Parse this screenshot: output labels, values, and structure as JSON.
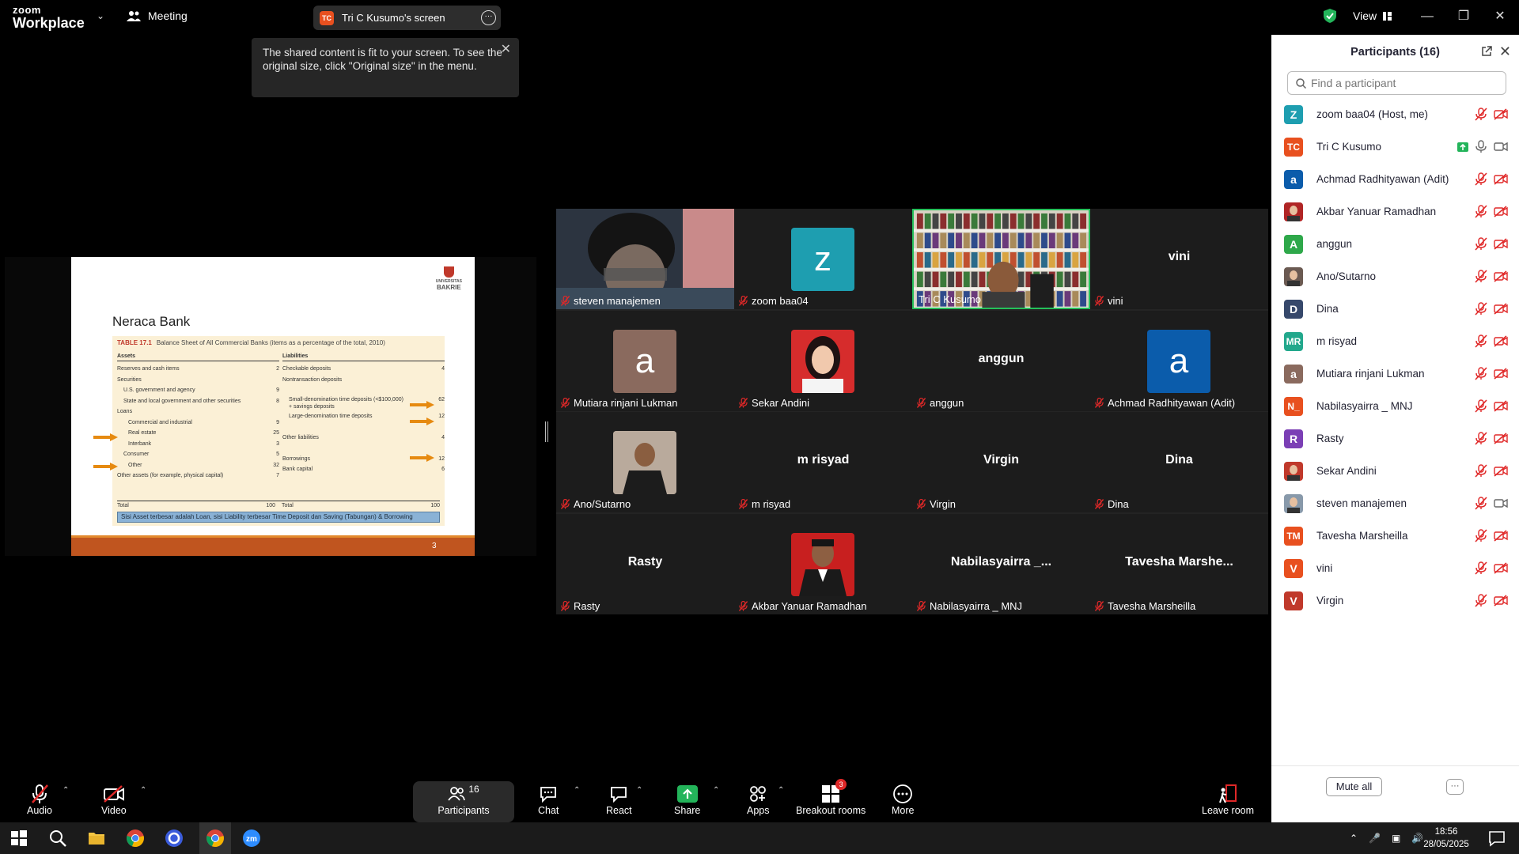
{
  "app": {
    "logo_top": "zoom",
    "logo_bottom": "Workplace",
    "meeting_label": "Meeting",
    "screen_tab_badge": "TC",
    "screen_tab_label": "Tri C Kusumo's screen",
    "view_label": "View",
    "tooltip": "The shared content is fit to your screen. To see the original size, click \"Original size\" in the menu."
  },
  "slide": {
    "logo_text": "BAKRIE",
    "logo_small": "UNIVERSITAS",
    "title": "Neraca Bank",
    "table_caption": "TABLE 17.1",
    "table_subtitle": "Balance Sheet of All Commercial Banks (items as a percentage of the total, 2010)",
    "assets_header": "Assets",
    "liabilities_header": "Liabilities",
    "assets": [
      {
        "label": "Reserves and cash items",
        "value": "2",
        "indent": 0
      },
      {
        "label": "Securities",
        "value": "",
        "indent": 0
      },
      {
        "label": "U.S. government and agency",
        "value": "9",
        "indent": 1
      },
      {
        "label": "State and local government and other securities",
        "value": "8",
        "indent": 1
      },
      {
        "label": "Loans",
        "value": "",
        "indent": 0
      },
      {
        "label": "Commercial and industrial",
        "value": "9",
        "indent": 2
      },
      {
        "label": "Real estate",
        "value": "25",
        "indent": 2
      },
      {
        "label": "Interbank",
        "value": "3",
        "indent": 2
      },
      {
        "label": "Consumer",
        "value": "5",
        "indent": 1
      },
      {
        "label": "Other",
        "value": "32",
        "indent": 2
      },
      {
        "label": "Other assets (for example, physical capital)",
        "value": "7",
        "indent": 0
      }
    ],
    "liabilities": [
      {
        "label": "Checkable deposits",
        "value": "4"
      },
      {
        "label": "Nontransaction deposits",
        "value": ""
      },
      {
        "label": "",
        "value": ""
      },
      {
        "label": "Small-denomination time deposits (<$100,000) + savings deposits",
        "value": "62"
      },
      {
        "label": "Large-denomination time deposits",
        "value": "12"
      },
      {
        "label": "",
        "value": ""
      },
      {
        "label": "Other liabilities",
        "value": "4"
      },
      {
        "label": "",
        "value": ""
      },
      {
        "label": "Borrowings",
        "value": "12"
      },
      {
        "label": "Bank capital",
        "value": "6"
      }
    ],
    "total_label": "Total",
    "total_assets": "100",
    "total_liabilities": "100",
    "note": "Sisi Asset terbesar adalah Loan, sisi Liability terbesar Time Deposit  dan Saving (Tabungan) & Borrowing",
    "page_number": "3"
  },
  "tiles": [
    {
      "label": "steven manajemen",
      "type": "photo",
      "photo": "steven"
    },
    {
      "label": "zoom baa04",
      "type": "avatar",
      "letter": "z",
      "color": "#1e9eb0"
    },
    {
      "label": "Tri C Kusumo",
      "type": "photo",
      "photo": "books",
      "active": true
    },
    {
      "label": "vini",
      "type": "name",
      "name": "vini"
    },
    {
      "label": "Mutiara rinjani Lukman",
      "type": "avatar",
      "letter": "a",
      "color": "#8a6a5e"
    },
    {
      "label": "Sekar Andini",
      "type": "photo",
      "photo": "sekar"
    },
    {
      "label": "anggun",
      "type": "name",
      "name": "anggun"
    },
    {
      "label": "Achmad Radhityawan (Adit)",
      "type": "avatar",
      "letter": "a",
      "color": "#0b5cab"
    },
    {
      "label": "Ano/Sutarno",
      "type": "photo",
      "photo": "ano"
    },
    {
      "label": "m risyad",
      "type": "name",
      "name": "m risyad"
    },
    {
      "label": "Virgin",
      "type": "name",
      "name": "Virgin"
    },
    {
      "label": "Dina",
      "type": "name",
      "name": "Dina"
    },
    {
      "label": "Rasty",
      "type": "name",
      "name": "Rasty"
    },
    {
      "label": "Akbar Yanuar Ramadhan",
      "type": "photo",
      "photo": "akbar"
    },
    {
      "label": "Nabilasyairra _ MNJ",
      "type": "name",
      "name": "Nabilasyairra _..."
    },
    {
      "label": "Tavesha Marsheilla",
      "type": "name",
      "name": "Tavesha  Marshe..."
    }
  ],
  "panel": {
    "title": "Participants (16)",
    "search_placeholder": "Find a participant",
    "mute_all": "Mute all",
    "participants": [
      {
        "name": "zoom baa04 (Host, me)",
        "initials": "Z",
        "color": "#1e9eb0",
        "video": "off",
        "mic": "muted"
      },
      {
        "name": "Tri C Kusumo",
        "initials": "TC",
        "color": "#e8501f",
        "video": "on",
        "mic": "on",
        "sharing": true
      },
      {
        "name": "Achmad Radhityawan (Adit)",
        "initials": "a",
        "color": "#0b5cab",
        "video": "off",
        "mic": "muted"
      },
      {
        "name": "Akbar Yanuar Ramadhan",
        "initials": "",
        "color": "#b02525",
        "video": "off",
        "mic": "muted",
        "photo": true
      },
      {
        "name": "anggun",
        "initials": "A",
        "color": "#2ea84a",
        "video": "off",
        "mic": "muted"
      },
      {
        "name": "Ano/Sutarno",
        "initials": "",
        "color": "#6b5a52",
        "video": "off",
        "mic": "muted",
        "photo": true
      },
      {
        "name": "Dina",
        "initials": "D",
        "color": "#36486b",
        "video": "off",
        "mic": "muted"
      },
      {
        "name": "m risyad",
        "initials": "MR",
        "color": "#22a88c",
        "video": "off",
        "mic": "muted"
      },
      {
        "name": "Mutiara rinjani Lukman",
        "initials": "a",
        "color": "#8a6a5e",
        "video": "off",
        "mic": "muted"
      },
      {
        "name": "Nabilasyairra _ MNJ",
        "initials": "N_",
        "color": "#e8501f",
        "video": "off",
        "mic": "muted"
      },
      {
        "name": "Rasty",
        "initials": "R",
        "color": "#7b3fb5",
        "video": "off",
        "mic": "muted"
      },
      {
        "name": "Sekar Andini",
        "initials": "",
        "color": "#c0392b",
        "video": "off",
        "mic": "muted",
        "photo": true
      },
      {
        "name": "steven manajemen",
        "initials": "",
        "color": "#8899aa",
        "video": "on",
        "mic": "muted",
        "photo": true
      },
      {
        "name": "Tavesha Marsheilla",
        "initials": "TM",
        "color": "#e8501f",
        "video": "off",
        "mic": "muted"
      },
      {
        "name": "vini",
        "initials": "V",
        "color": "#e8501f",
        "video": "off",
        "mic": "muted"
      },
      {
        "name": "Virgin",
        "initials": "V",
        "color": "#c0392b",
        "video": "off",
        "mic": "muted"
      }
    ]
  },
  "toolbar": {
    "audio": "Audio",
    "video": "Video",
    "participants": "Participants",
    "participants_count": "16",
    "chat": "Chat",
    "react": "React",
    "share": "Share",
    "apps": "Apps",
    "breakout": "Breakout rooms",
    "breakout_badge": "3",
    "more": "More",
    "leave": "Leave room"
  },
  "taskbar": {
    "time": "18:56",
    "date": "28/05/2025"
  },
  "colors": {
    "accent_green": "#25c05a",
    "mute_red": "#e02828",
    "panel_bg": "#ffffff"
  }
}
